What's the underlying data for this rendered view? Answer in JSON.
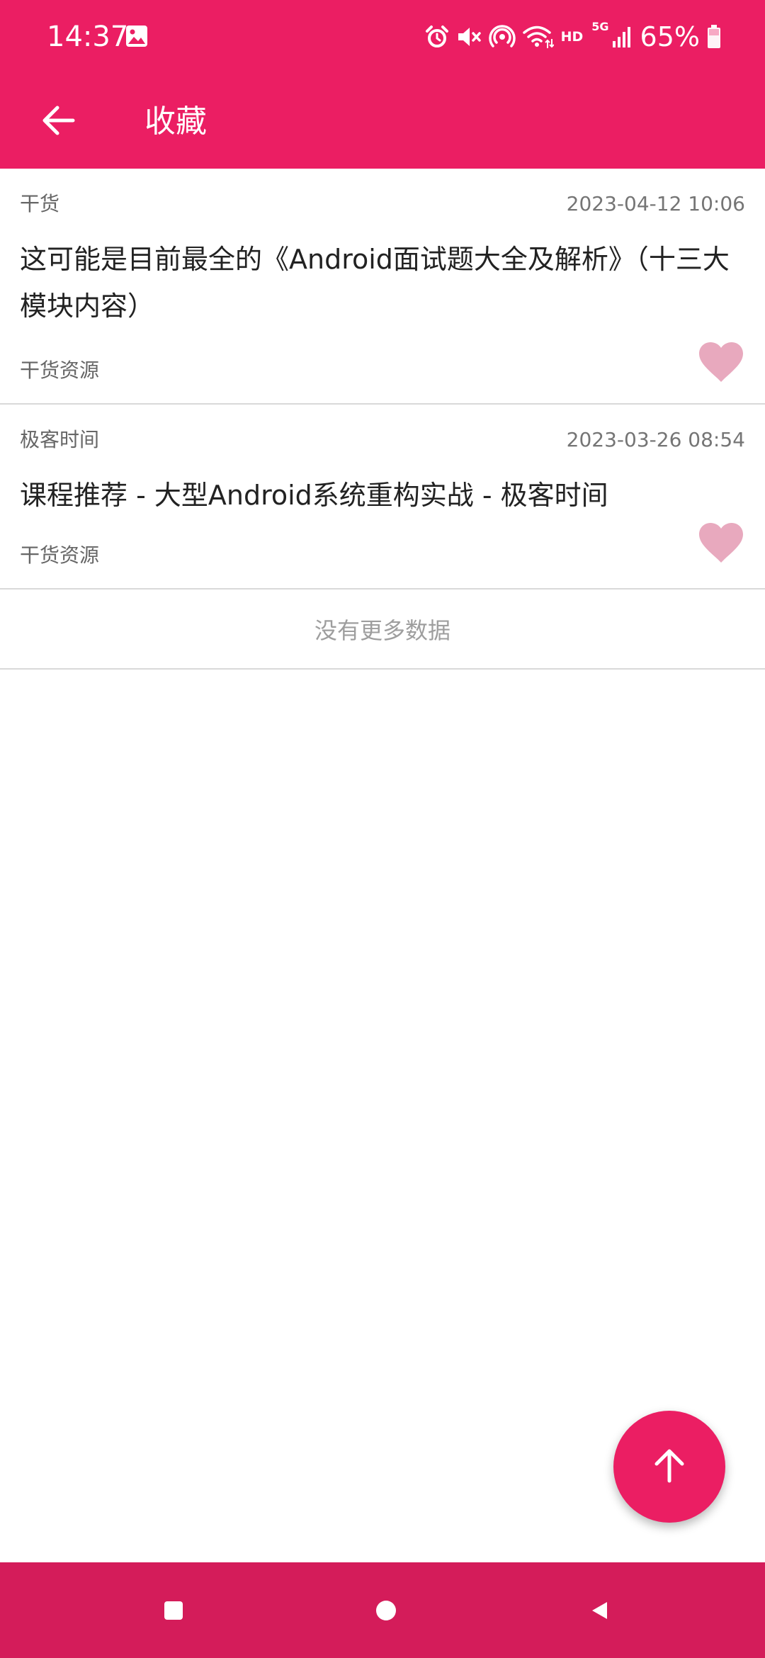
{
  "status_bar": {
    "time": "14:37",
    "hd": "HD",
    "network": "5G",
    "battery": "65%",
    "icons": [
      "image-icon",
      "alarm-icon",
      "mute-icon",
      "hotspot-icon",
      "wifi-icon",
      "signal-icon",
      "battery-icon"
    ]
  },
  "app_bar": {
    "title": "收藏",
    "back_icon": "arrow-left-icon"
  },
  "items": [
    {
      "category": "干货",
      "date": "2023-04-12 10:06",
      "title": "这可能是目前最全的《Android面试题大全及解析》（十三大模块内容）",
      "tag": "干货资源",
      "favorite_icon": "heart-icon"
    },
    {
      "category": "极客时间",
      "date": "2023-03-26 08:54",
      "title": "课程推荐 - 大型Android系统重构实战 - 极客时间",
      "tag": "干货资源",
      "favorite_icon": "heart-icon"
    }
  ],
  "list_footer": "没有更多数据",
  "fab": {
    "icon": "arrow-up-icon"
  },
  "nav_bar": {
    "icons": [
      "recents-icon",
      "home-icon",
      "back-icon"
    ]
  },
  "colors": {
    "primary": "#EB1E63",
    "nav_bar": "#D41C5A",
    "heart": "#E8A9BE"
  }
}
